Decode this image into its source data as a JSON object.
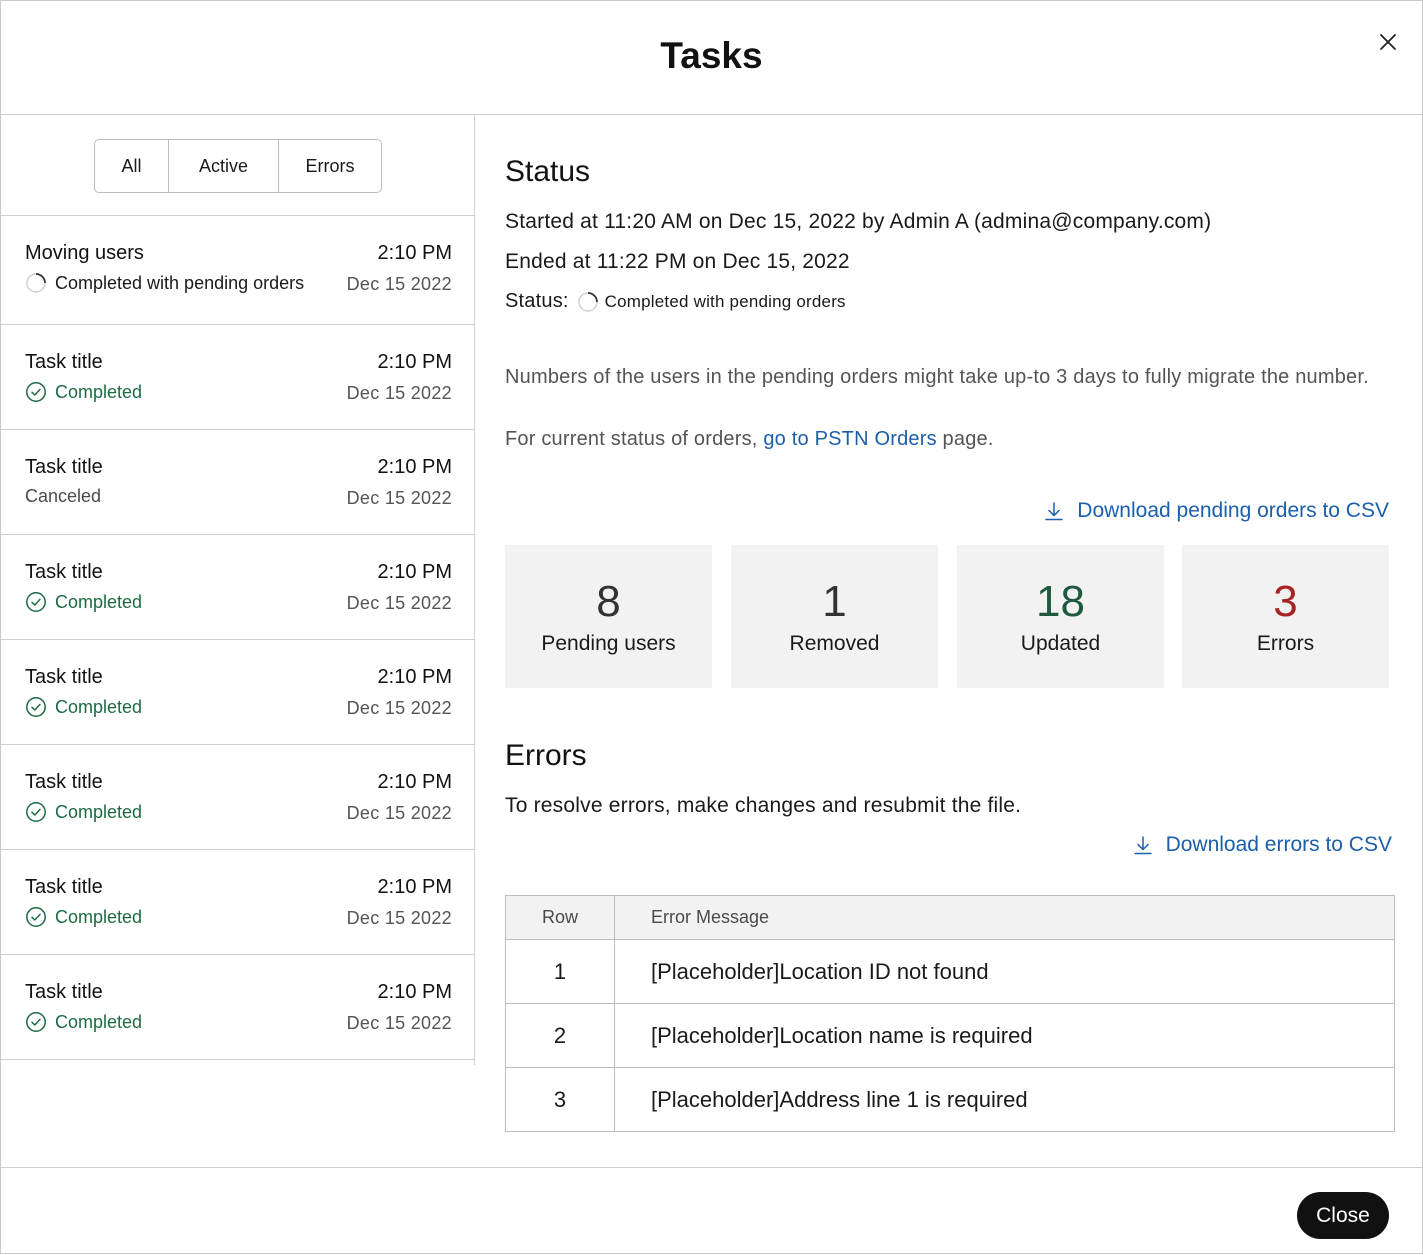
{
  "modal": {
    "title": "Tasks",
    "close_button": "Close"
  },
  "filters": [
    "All",
    "Active",
    "Errors"
  ],
  "tasks": [
    {
      "name": "Moving users",
      "time": "2:10 PM",
      "date": "Dec 15 2022",
      "status": "Completed with pending orders",
      "status_type": "pending"
    },
    {
      "name": "Task title",
      "time": "2:10 PM",
      "date": "Dec 15 2022",
      "status": "Completed",
      "status_type": "done"
    },
    {
      "name": "Task title",
      "time": "2:10 PM",
      "date": "Dec 15 2022",
      "status": "Canceled",
      "status_type": "canceled"
    },
    {
      "name": "Task title",
      "time": "2:10 PM",
      "date": "Dec 15 2022",
      "status": "Completed",
      "status_type": "done"
    },
    {
      "name": "Task title",
      "time": "2:10 PM",
      "date": "Dec 15 2022",
      "status": "Completed",
      "status_type": "done"
    },
    {
      "name": "Task title",
      "time": "2:10 PM",
      "date": "Dec 15 2022",
      "status": "Completed",
      "status_type": "done"
    },
    {
      "name": "Task title",
      "time": "2:10 PM",
      "date": "Dec 15 2022",
      "status": "Completed",
      "status_type": "done"
    },
    {
      "name": "Task title",
      "time": "2:10 PM",
      "date": "Dec 15 2022",
      "status": "Completed",
      "status_type": "done"
    }
  ],
  "status": {
    "heading": "Status",
    "started": "Started at 11:20 AM on Dec 15, 2022 by Admin A (admina@company.com)",
    "ended": "Ended at 11:22 PM on Dec 15, 2022",
    "label": "Status:",
    "value": "Completed with pending orders",
    "note": "Numbers of the users in the pending orders might take up-to 3 days to fully migrate the number.",
    "orders_prefix": "For current status of orders, ",
    "orders_link": "go to PSTN Orders",
    "orders_suffix": " page.",
    "download_pending": "Download pending orders to CSV"
  },
  "stats": [
    {
      "value": "8",
      "label": "Pending users",
      "color": "#333333"
    },
    {
      "value": "1",
      "label": "Removed",
      "color": "#333333"
    },
    {
      "value": "18",
      "label": "Updated",
      "color": "#1f5a3f"
    },
    {
      "value": "3",
      "label": "Errors",
      "color": "#a82424"
    }
  ],
  "errors": {
    "heading": "Errors",
    "description": "To resolve errors, make changes and resubmit the file.",
    "download": "Download errors to CSV",
    "columns": [
      "Row",
      "Error Message"
    ],
    "rows": [
      {
        "row": "1",
        "message": "[Placeholder]Location ID not found"
      },
      {
        "row": "2",
        "message": "[Placeholder]Location name is required"
      },
      {
        "row": "3",
        "message": "[Placeholder]Address line 1 is required"
      }
    ]
  }
}
